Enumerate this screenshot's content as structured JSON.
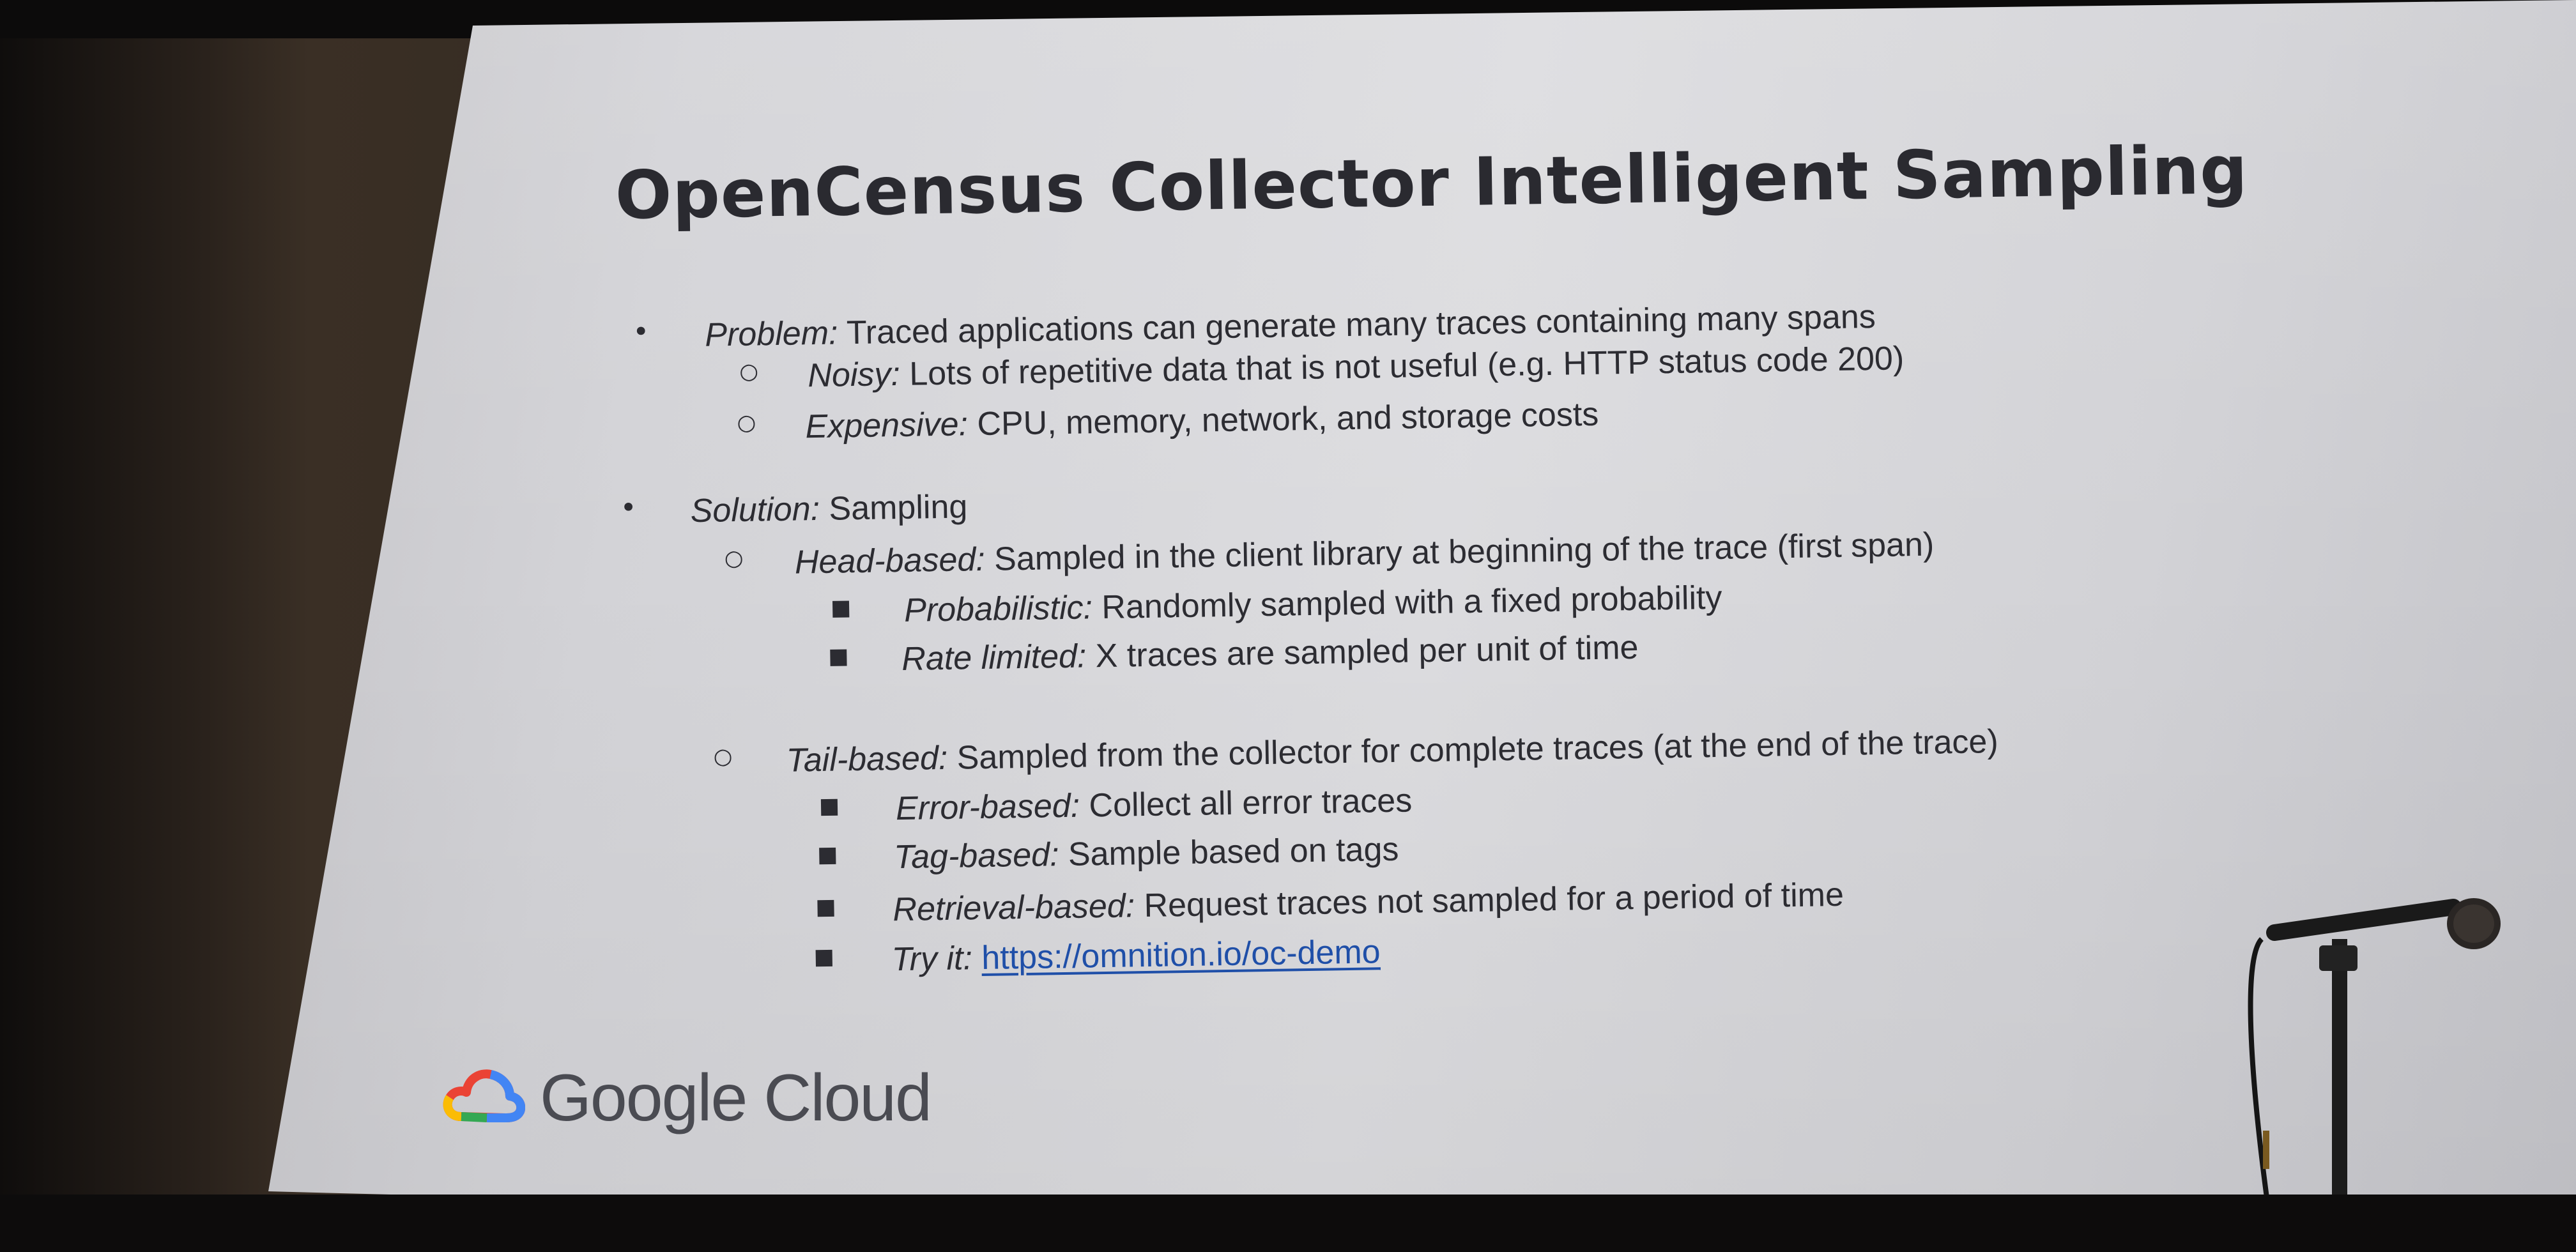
{
  "slide": {
    "title": "OpenCensus Collector Intelligent Sampling",
    "items": [
      {
        "level": 1,
        "bullet": "•",
        "key": "Problem:",
        "text": " Traced applications can generate many traces containing many spans"
      },
      {
        "level": 2,
        "bullet": "○",
        "key": "Noisy:",
        "text": " Lots of repetitive data that is not useful (e.g. HTTP status code 200)"
      },
      {
        "level": 2,
        "bullet": "○",
        "key": "Expensive:",
        "text": " CPU, memory, network, and storage costs"
      },
      {
        "level": 1,
        "bullet": "•",
        "key": "Solution:",
        "text": " Sampling"
      },
      {
        "level": 2,
        "bullet": "○",
        "key": "Head-based:",
        "text": " Sampled in the client library at beginning of the trace (first span)"
      },
      {
        "level": 3,
        "bullet": "■",
        "key": "Probabilistic:",
        "text": " Randomly sampled with a fixed probability"
      },
      {
        "level": 3,
        "bullet": "■",
        "key": "Rate limited:",
        "text": " X traces are sampled per unit of time"
      },
      {
        "level": 2,
        "bullet": "○",
        "key": "Tail-based:",
        "text": " Sampled from the collector for complete traces (at the end of the trace)"
      },
      {
        "level": 3,
        "bullet": "■",
        "key": "Error-based:",
        "text": " Collect all error traces"
      },
      {
        "level": 3,
        "bullet": "■",
        "key": "Tag-based:",
        "text": " Sample based on tags"
      },
      {
        "level": 3,
        "bullet": "■",
        "key": "Retrieval-based:",
        "text": " Request traces not sampled for a period of time"
      },
      {
        "level": 3,
        "bullet": "■",
        "key": "Try it:",
        "text": " ",
        "link": "https://omnition.io/oc-demo"
      }
    ],
    "logo_text": "Google Cloud",
    "logo_icon": "google-cloud-logo-icon"
  },
  "colors": {
    "text": "#2c2c32",
    "title": "#2a2a30",
    "link": "#1f4fa8",
    "logo_red": "#ea4335",
    "logo_blue": "#4285f4",
    "logo_yellow": "#fbbc05",
    "logo_green": "#34a853"
  }
}
